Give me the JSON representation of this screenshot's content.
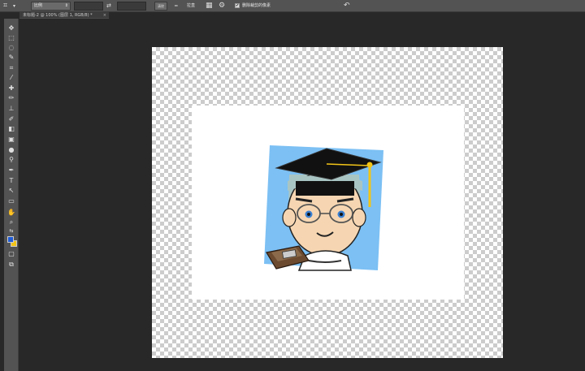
{
  "options_bar": {
    "ratio_value": "比例",
    "clear_label": "清除",
    "straighten_label": "拉直",
    "delete_cropped_label": "删除裁剪的像素"
  },
  "document": {
    "tab_title": "未标题-2 @ 100% (图层 1, RGB/8) *",
    "close_glyph": "×"
  },
  "colors": {
    "foreground": "#1e5bd6",
    "background": "#f2c418"
  },
  "icons": {
    "crop": "✂",
    "swap": "⇄",
    "grid": "#",
    "settings": "⚙",
    "reset": "↶",
    "check": "✔"
  },
  "tools": [
    "move",
    "marquee",
    "lasso",
    "quick-select",
    "crop",
    "eyedropper",
    "healing",
    "brush",
    "stamp",
    "history-brush",
    "eraser",
    "gradient",
    "blur",
    "dodge",
    "pen",
    "type",
    "path-select",
    "rectangle",
    "hand",
    "zoom"
  ]
}
